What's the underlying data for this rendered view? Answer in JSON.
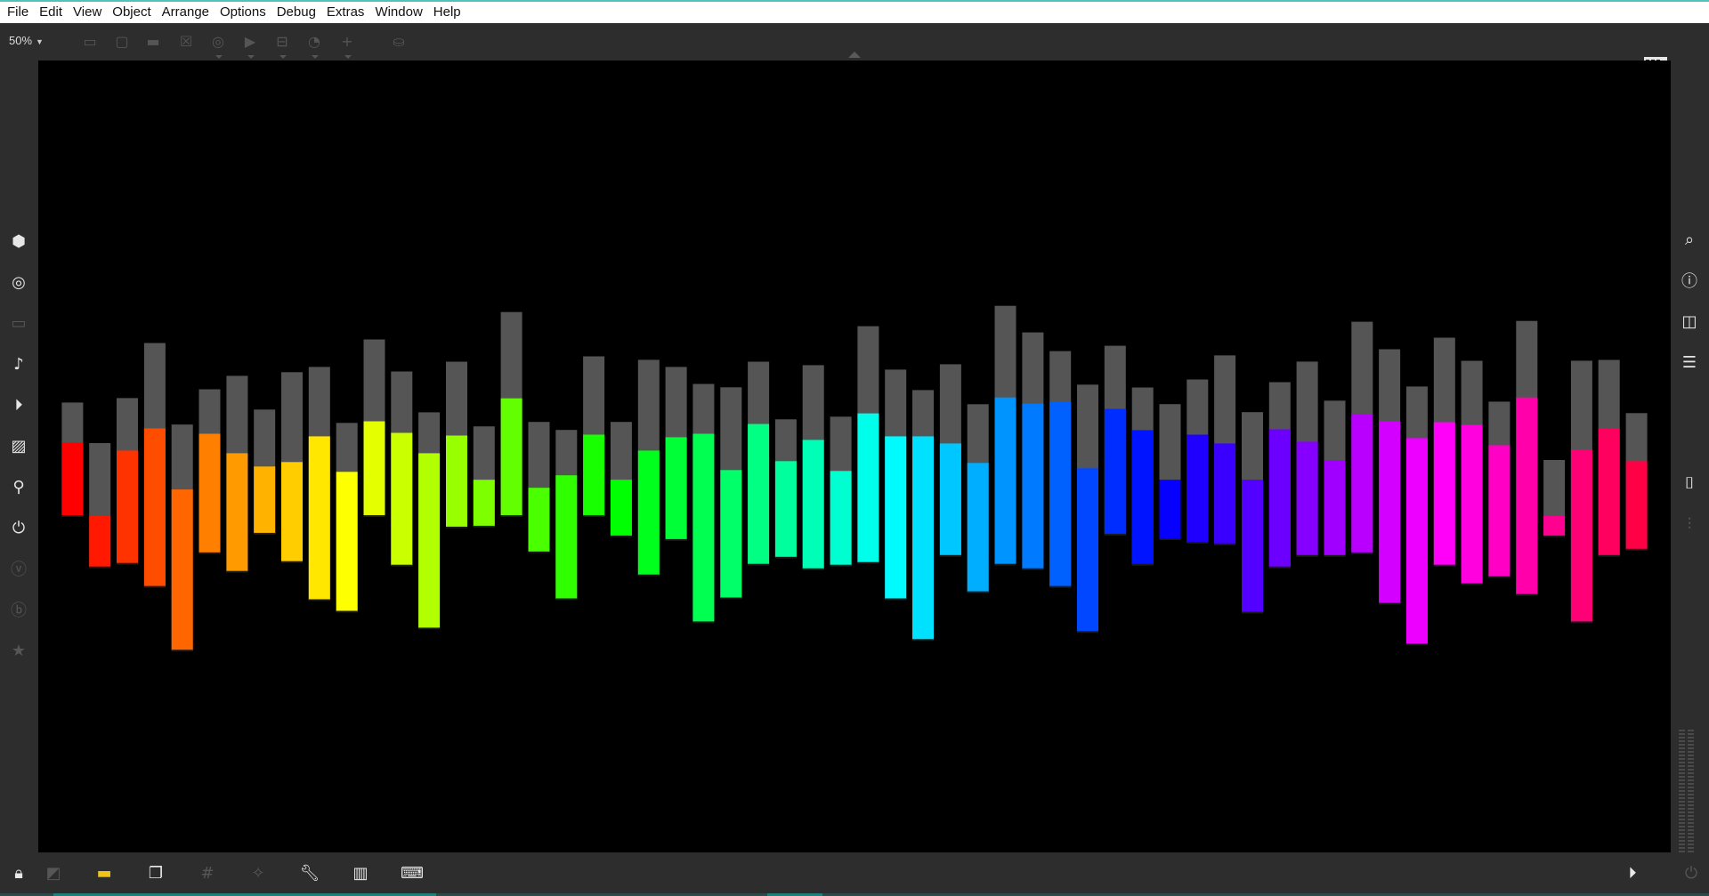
{
  "menubar": {
    "items": [
      "File",
      "Edit",
      "View",
      "Object",
      "Arrange",
      "Options",
      "Debug",
      "Extras",
      "Window",
      "Help"
    ]
  },
  "toolbar": {
    "zoom": "50%",
    "buttons": [
      "presentation-mode",
      "comment",
      "message",
      "toggle-box",
      "circle-button",
      "play-button",
      "split-box",
      "dial",
      "add",
      "paint-bucket"
    ]
  },
  "left_sidebar": {
    "icons": [
      "package",
      "target",
      "slider",
      "music-note",
      "step-sequencer",
      "image",
      "paperclip",
      "plug",
      "vizzie",
      "beap",
      "star"
    ]
  },
  "right_sidebar": {
    "icons": [
      "search",
      "info",
      "columns",
      "list",
      "snapshot",
      "mixer"
    ]
  },
  "bottom_bar": {
    "icons": [
      "lock",
      "edit-mode",
      "presentation",
      "layers",
      "grid",
      "snap-wand",
      "wrench",
      "piano",
      "keyboard",
      "transport",
      "power"
    ]
  },
  "colors": {
    "canvas": "#000000",
    "track": "#555555",
    "chrome": "#2d2d2d",
    "menubar": "#ffffff",
    "accent_strip": "#4fc3b9"
  },
  "chart_data": {
    "type": "bar",
    "description_note": "",
    "tracks": [
      {
        "top": 8.3,
        "bottom": 0.0
      },
      {
        "top": 0.0,
        "bottom": -5.8
      },
      {
        "top": 7.4,
        "bottom": -5.4
      },
      {
        "top": 9.9,
        "bottom": -8.0
      },
      {
        "top": 3.0,
        "bottom": -15.2
      },
      {
        "top": 9.3,
        "bottom": -4.2
      },
      {
        "top": 7.1,
        "bottom": -6.3
      },
      {
        "top": 5.6,
        "bottom": -2.0
      },
      {
        "top": 6.1,
        "bottom": -5.2
      },
      {
        "top": 9.0,
        "bottom": -9.5
      },
      {
        "top": 5.0,
        "bottom": -10.8
      },
      {
        "top": 10.7,
        "bottom": 0.0
      },
      {
        "top": 9.4,
        "bottom": -5.6
      },
      {
        "top": 7.1,
        "bottom": -12.7
      },
      {
        "top": 9.1,
        "bottom": -1.3
      },
      {
        "top": 4.1,
        "bottom": -1.2
      },
      {
        "top": 13.3,
        "bottom": 0.0
      },
      {
        "top": 3.2,
        "bottom": -4.1
      },
      {
        "top": 4.6,
        "bottom": -9.4
      },
      {
        "top": 9.2,
        "bottom": 0.0
      },
      {
        "top": 4.1,
        "bottom": -2.3
      },
      {
        "top": 7.4,
        "bottom": -6.7
      },
      {
        "top": 8.9,
        "bottom": -2.7
      },
      {
        "top": 9.3,
        "bottom": -12.0
      },
      {
        "top": 5.2,
        "bottom": -9.3
      },
      {
        "top": 10.4,
        "bottom": -5.5
      },
      {
        "top": 6.2,
        "bottom": -4.7
      },
      {
        "top": 8.6,
        "bottom": -6.0
      },
      {
        "top": 5.1,
        "bottom": -5.6
      },
      {
        "top": 11.6,
        "bottom": -5.3
      },
      {
        "top": 9.0,
        "bottom": -9.4
      },
      {
        "top": 9.0,
        "bottom": -14.0
      },
      {
        "top": 8.2,
        "bottom": -4.5
      },
      {
        "top": 6.0,
        "bottom": -8.6
      },
      {
        "top": 13.4,
        "bottom": -5.5
      },
      {
        "top": 12.7,
        "bottom": -6.0
      },
      {
        "top": 12.9,
        "bottom": -8.0
      },
      {
        "top": 5.4,
        "bottom": -13.1
      },
      {
        "top": 12.1,
        "bottom": -2.1
      },
      {
        "top": 9.7,
        "bottom": -5.5
      },
      {
        "top": 4.1,
        "bottom": -2.6
      },
      {
        "top": 9.2,
        "bottom": -3.0
      },
      {
        "top": 8.2,
        "bottom": -3.2
      },
      {
        "top": 4.1,
        "bottom": -10.9
      },
      {
        "top": 9.8,
        "bottom": -5.8
      },
      {
        "top": 8.4,
        "bottom": -4.5
      },
      {
        "top": 6.3,
        "bottom": -4.5
      },
      {
        "top": 11.5,
        "bottom": -4.2
      },
      {
        "top": 10.7,
        "bottom": -9.9
      },
      {
        "top": 8.8,
        "bottom": -14.5
      },
      {
        "top": 10.6,
        "bottom": -5.6
      },
      {
        "top": 10.3,
        "bottom": -7.7
      },
      {
        "top": 8.0,
        "bottom": -6.9
      },
      {
        "top": 13.4,
        "bottom": -8.9
      },
      {
        "top": 0.0,
        "bottom": -2.3
      },
      {
        "top": 7.5,
        "bottom": -12.0
      },
      {
        "top": 9.9,
        "bottom": -4.5
      },
      {
        "top": 6.2,
        "bottom": -3.8
      }
    ]
  }
}
